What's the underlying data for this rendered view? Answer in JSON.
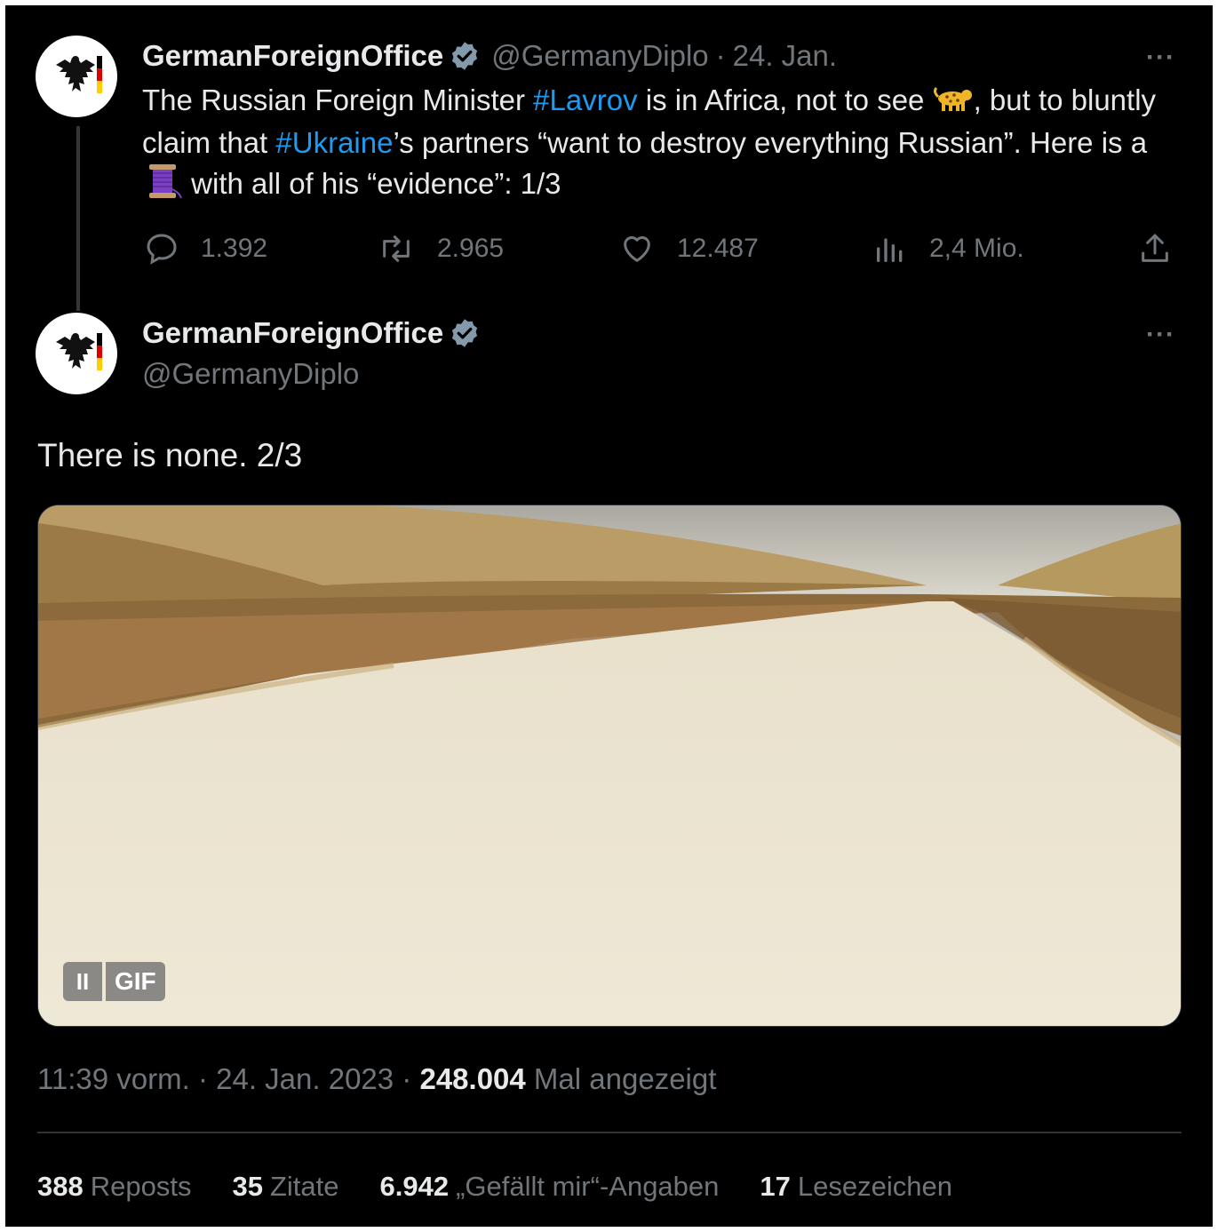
{
  "tweet1": {
    "name": "GermanForeignOffice",
    "handle": "@GermanyDiplo",
    "date": "24. Jan.",
    "text_parts": {
      "p1": "The Russian Foreign Minister ",
      "tag1": "#Lavrov",
      "p2": " is in Africa, not to see ",
      "p3": ", but to bluntly claim that ",
      "tag2": "#Ukraine",
      "p4": "’s partners “want to destroy everything Russian”. Here is a ",
      "p5": " with all of his “evidence”: 1/3"
    },
    "emoji_1": "leopard",
    "emoji_2": "thread-spool",
    "actions": {
      "replies": "1.392",
      "reposts": "2.965",
      "likes": "12.487",
      "views": "2,4 Mio."
    }
  },
  "tweet2": {
    "name": "GermanForeignOffice",
    "handle": "@GermanyDiplo",
    "text": "There is none. 2/3",
    "gif_pause": "II",
    "gif_label": "GIF",
    "meta": {
      "time": "11:39 vorm.",
      "sep": " · ",
      "date": "24. Jan. 2023",
      "views_count": "248.004",
      "views_label": " Mal angezeigt"
    },
    "stats": [
      {
        "num": "388",
        "label": "Reposts"
      },
      {
        "num": "35",
        "label": "Zitate"
      },
      {
        "num": "6.942",
        "label": "„Gefällt mir“-Angaben"
      },
      {
        "num": "17",
        "label": "Lesezeichen"
      }
    ]
  },
  "colors": {
    "background": "#000000",
    "text": "#e7e9ea",
    "muted": "#71767b",
    "link": "#1d9bf0",
    "verified_badge": "#829aab"
  },
  "more_glyph": "···"
}
